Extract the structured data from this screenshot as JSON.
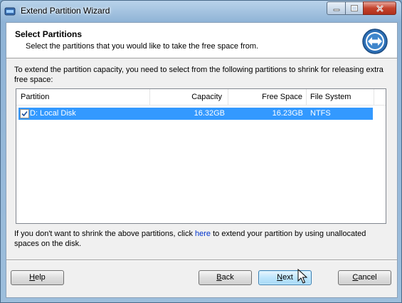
{
  "window": {
    "title": "Extend Partition Wizard"
  },
  "header": {
    "title": "Select Partitions",
    "subtitle": "Select the partitions that you would like to take the free space from."
  },
  "description": "To extend the partition capacity, you need to select from the following partitions to shrink for releasing extra free space:",
  "table": {
    "columns": [
      "Partition",
      "Capacity",
      "Free Space",
      "File System"
    ],
    "rows": [
      {
        "checked": true,
        "partition": "D: Local Disk",
        "capacity": "16.32GB",
        "free_space": "16.23GB",
        "file_system": "NTFS"
      }
    ]
  },
  "footer": {
    "text_before": "If you don't want to shrink the above partitions, click ",
    "link": "here",
    "text_after": " to extend your partition by using unallocated spaces on the disk."
  },
  "buttons": {
    "help": {
      "accel": "H",
      "rest": "elp"
    },
    "back": {
      "accel": "B",
      "rest": "ack"
    },
    "next": {
      "accel": "N",
      "rest": "ext"
    },
    "cancel": {
      "accel": "C",
      "rest": "ancel"
    }
  },
  "colors": {
    "selection": "#3399ff",
    "link": "#0033cc",
    "close_button": "#c4432c"
  },
  "icons": [
    "partition-wizard-app-icon",
    "minimize-icon",
    "maximize-icon",
    "close-icon",
    "partition-wizard-logo-icon",
    "checkbox-checked-icon",
    "mouse-cursor-icon"
  ]
}
